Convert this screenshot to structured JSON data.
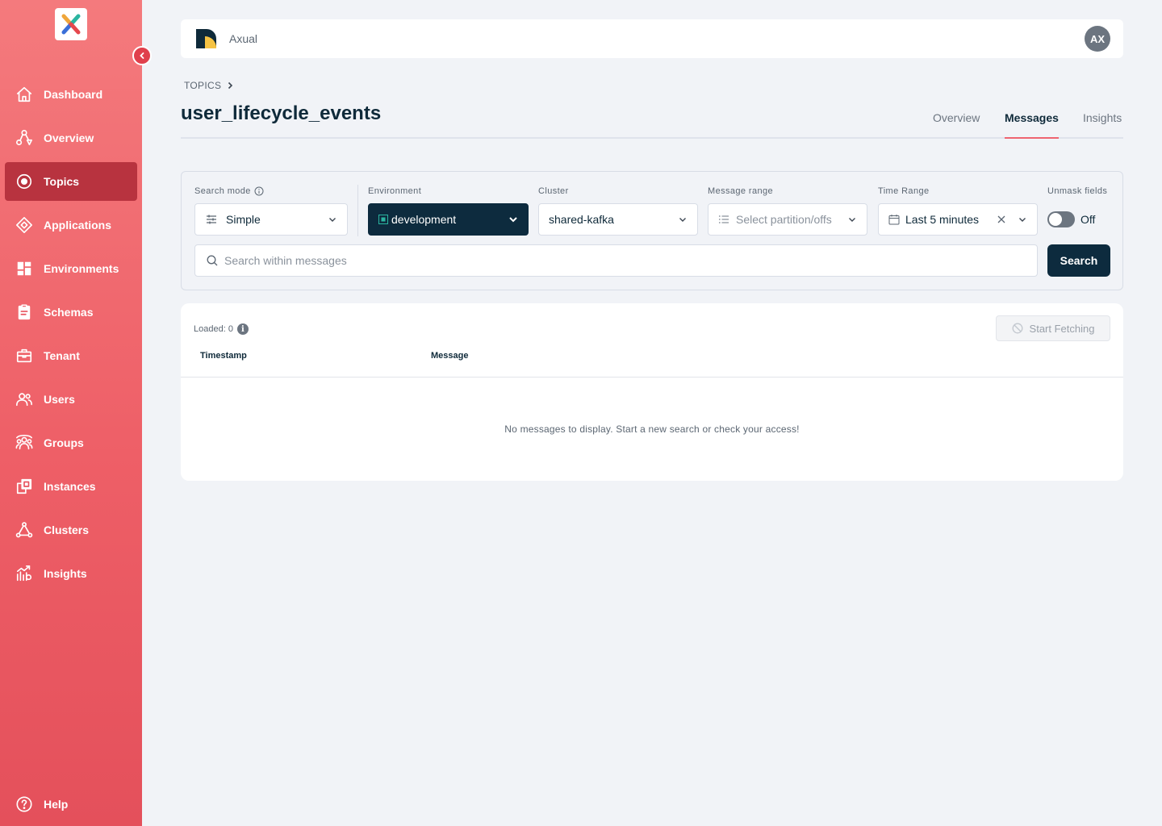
{
  "sidebar": {
    "items": [
      {
        "label": "Dashboard",
        "icon": "home-icon"
      },
      {
        "label": "Overview",
        "icon": "overview-icon"
      },
      {
        "label": "Topics",
        "icon": "topics-icon",
        "active": true
      },
      {
        "label": "Applications",
        "icon": "applications-icon"
      },
      {
        "label": "Environments",
        "icon": "environments-icon"
      },
      {
        "label": "Schemas",
        "icon": "schemas-icon"
      },
      {
        "label": "Tenant",
        "icon": "tenant-icon"
      },
      {
        "label": "Users",
        "icon": "users-icon"
      },
      {
        "label": "Groups",
        "icon": "groups-icon"
      },
      {
        "label": "Instances",
        "icon": "instances-icon"
      },
      {
        "label": "Clusters",
        "icon": "clusters-icon"
      },
      {
        "label": "Insights",
        "icon": "insights-icon"
      }
    ],
    "help_label": "Help"
  },
  "header": {
    "brand": "Axual",
    "avatar_initials": "AX"
  },
  "breadcrumb": {
    "root": "TOPICS"
  },
  "page": {
    "title": "user_lifecycle_events"
  },
  "tabs": [
    {
      "label": "Overview"
    },
    {
      "label": "Messages",
      "active": true
    },
    {
      "label": "Insights"
    }
  ],
  "filters": {
    "search_mode": {
      "label": "Search mode",
      "value": "Simple"
    },
    "environment": {
      "label": "Environment",
      "value": "development"
    },
    "cluster": {
      "label": "Cluster",
      "value": "shared-kafka"
    },
    "message_range": {
      "label": "Message range",
      "placeholder": "Select partition/offs"
    },
    "time_range": {
      "label": "Time Range",
      "value": "Last 5 minutes"
    },
    "unmask": {
      "label": "Unmask fields",
      "state": "Off"
    },
    "search_placeholder": "Search within messages",
    "search_button": "Search"
  },
  "results": {
    "loaded_label": "Loaded: 0",
    "fetch_button": "Start Fetching",
    "columns": [
      "Timestamp",
      "Message"
    ],
    "empty_message": "No messages to display. Start a new search or check your access!"
  },
  "colors": {
    "accent": "#ef6470",
    "sidebar_active": "#b8333f",
    "primary_dark": "#0d2b3e"
  }
}
